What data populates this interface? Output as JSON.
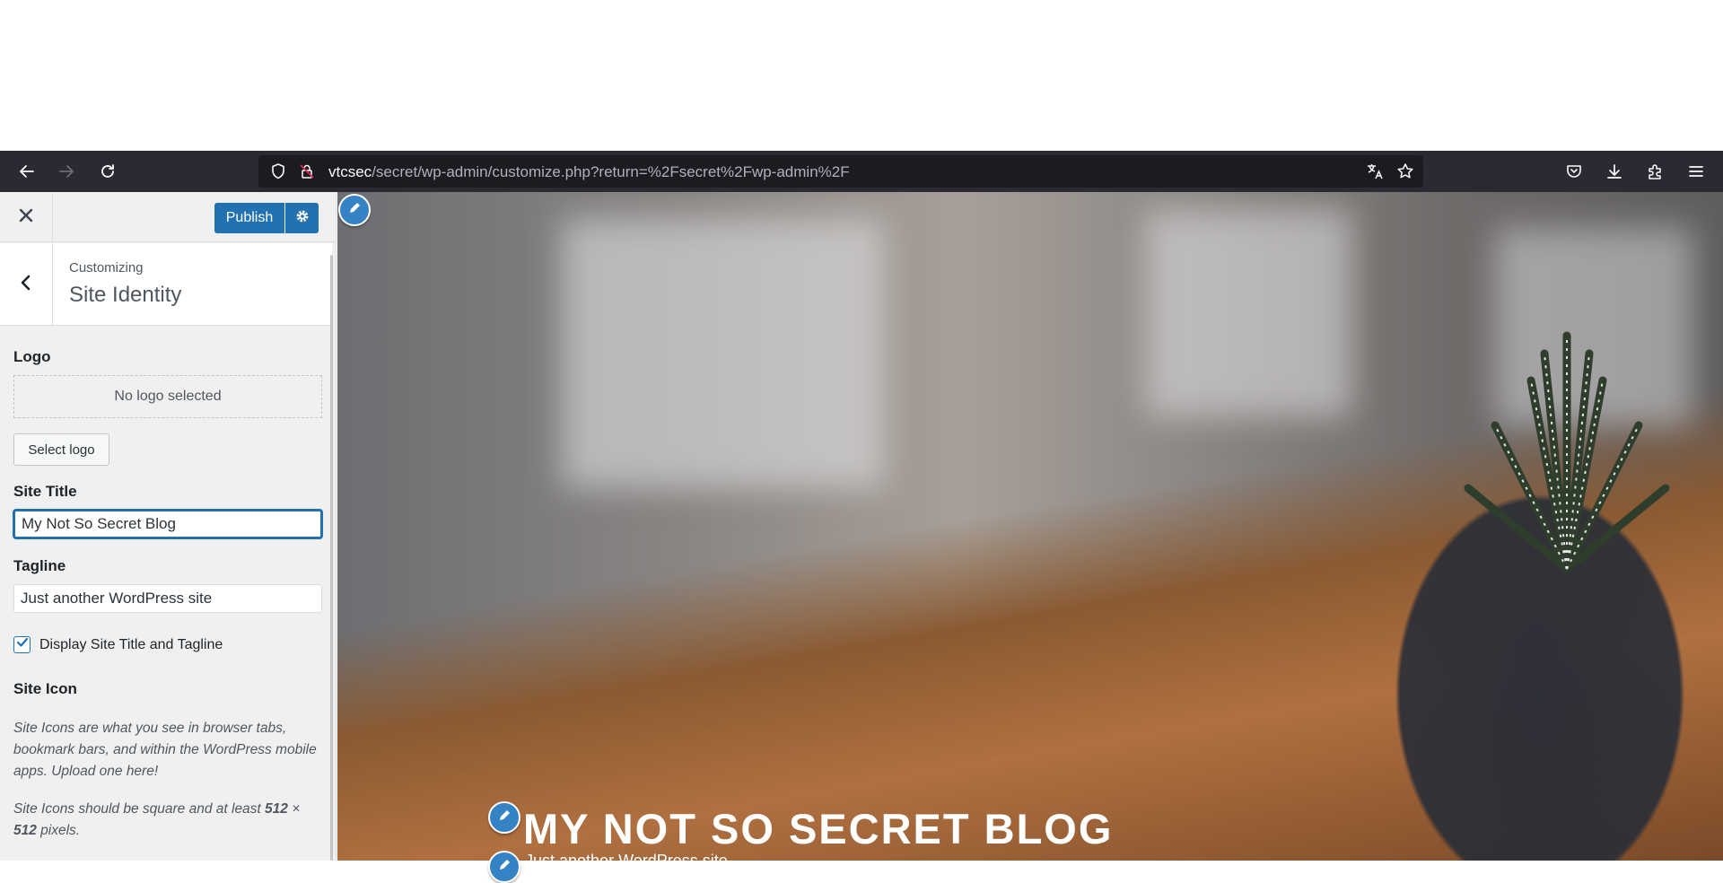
{
  "browser": {
    "url_host": "vtcsec",
    "url_path": "/secret/wp-admin/customize.php?return=%2Fsecret%2Fwp-admin%2F"
  },
  "customizer": {
    "publish_label": "Publish",
    "breadcrumb": "Customizing",
    "section_title": "Site Identity",
    "logo": {
      "title": "Logo",
      "placeholder": "No logo selected",
      "select_button": "Select logo"
    },
    "site_title": {
      "label": "Site Title",
      "value": "My Not So Secret Blog"
    },
    "tagline": {
      "label": "Tagline",
      "value": "Just another WordPress site"
    },
    "display_checkbox": {
      "label": "Display Site Title and Tagline",
      "checked": true
    },
    "site_icon": {
      "title": "Site Icon",
      "description": "Site Icons are what you see in browser tabs, bookmark bars, and within the WordPress mobile apps. Upload one here!",
      "requirement_prefix": "Site Icons should be square and at least ",
      "requirement_size_a": "512",
      "requirement_times": " × ",
      "requirement_size_b": "512",
      "requirement_suffix": " pixels."
    }
  },
  "preview": {
    "site_title": "MY NOT SO SECRET BLOG",
    "tagline": "Just another WordPress site"
  },
  "colors": {
    "accent": "#2271b1",
    "shortcut": "#3582c4",
    "toolbar": "#2b2a33"
  }
}
